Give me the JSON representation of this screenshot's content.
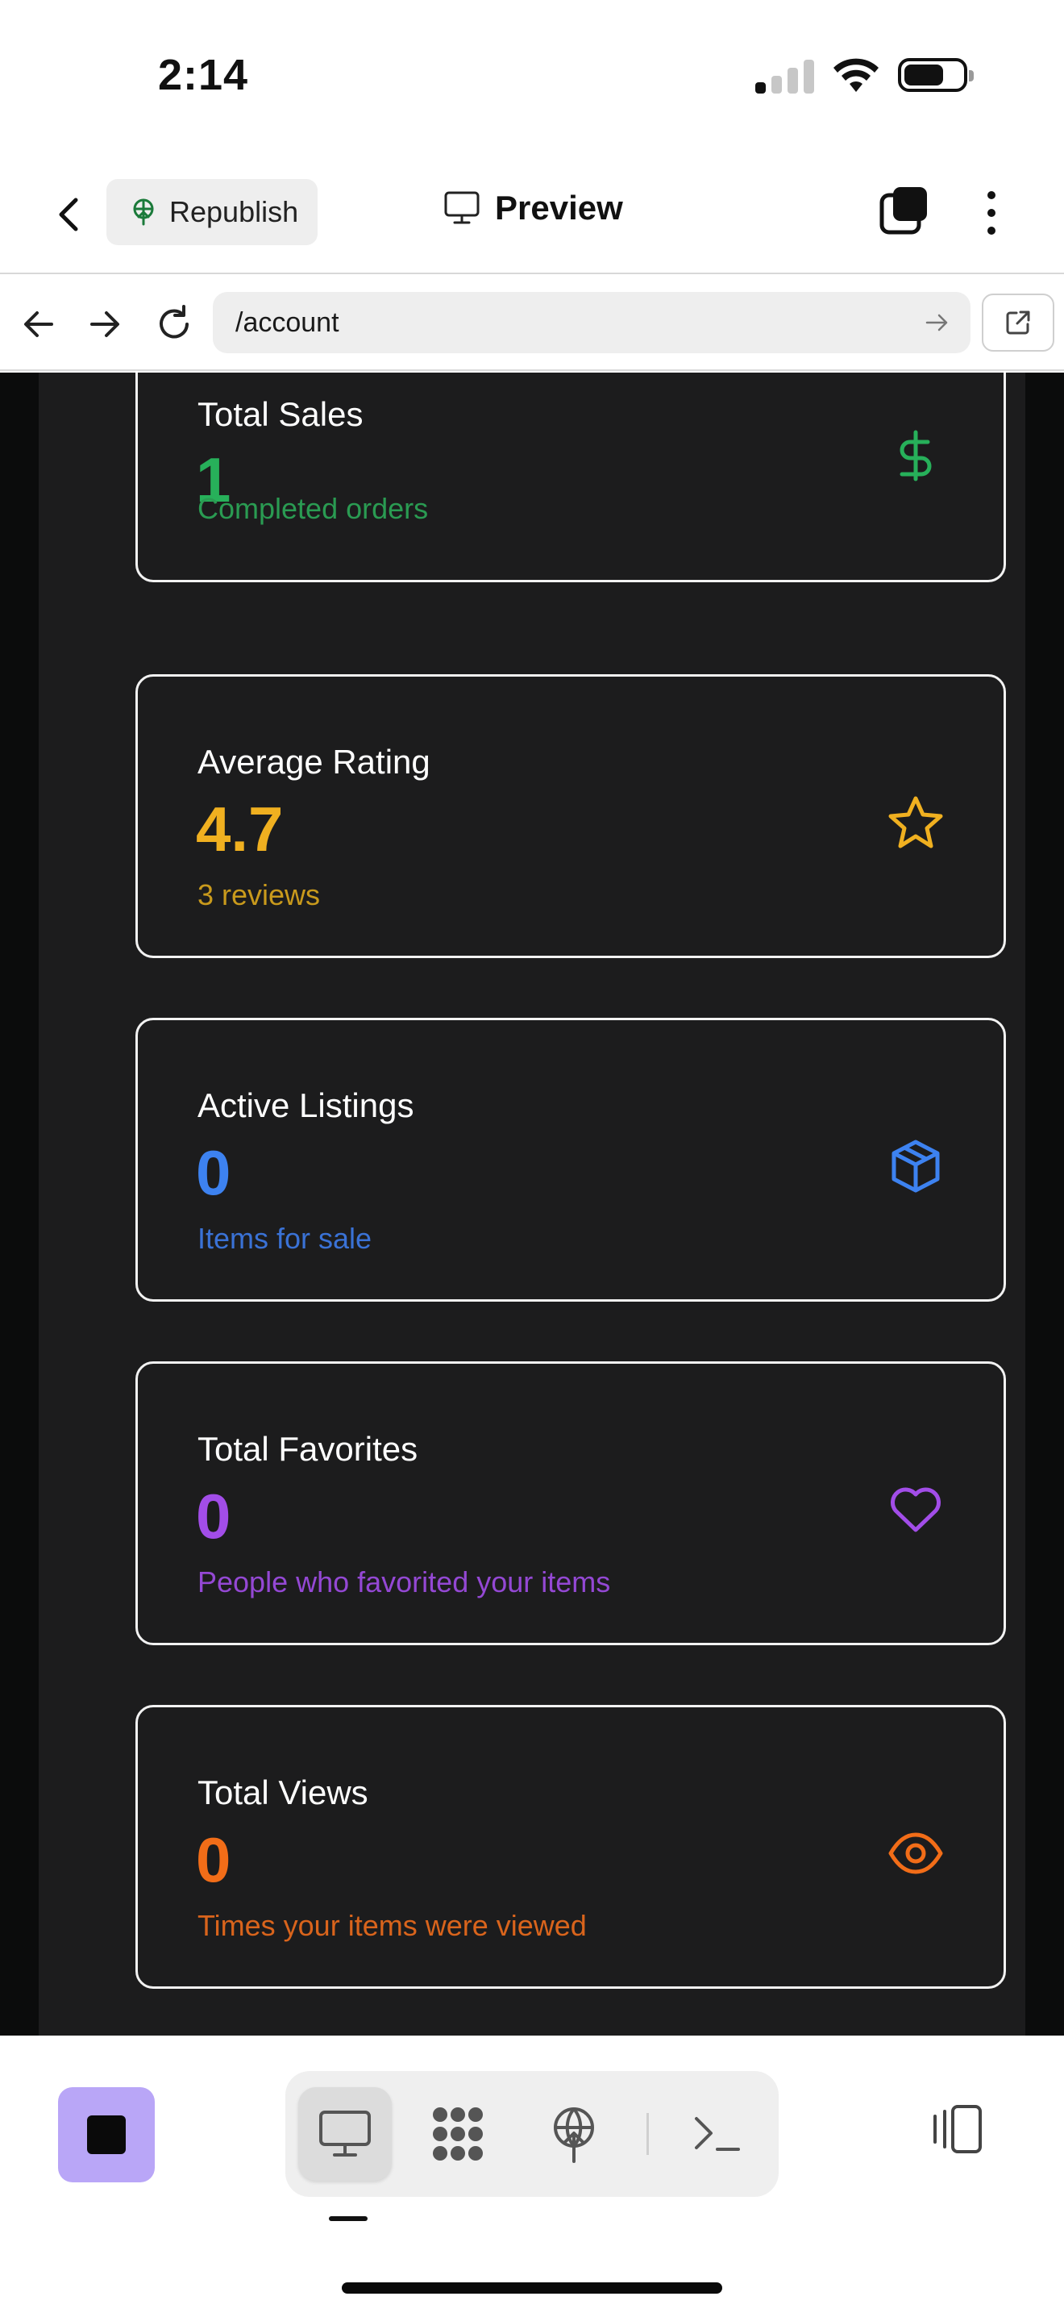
{
  "status_bar": {
    "time": "2:14"
  },
  "header": {
    "republish_label": "Republish",
    "preview_label": "Preview"
  },
  "url_bar": {
    "url": "/account"
  },
  "stats": [
    {
      "label": "Total Sales",
      "value": "1",
      "subtitle": "Completed orders",
      "icon": "dollar-icon",
      "color": "#27b05a",
      "sub_color": "#2a9b52"
    },
    {
      "label": "Average Rating",
      "value": "4.7",
      "subtitle": "3 reviews",
      "icon": "star-icon",
      "color": "#f0b020",
      "sub_color": "#c99a1c"
    },
    {
      "label": "Active Listings",
      "value": "0",
      "subtitle": "Items for sale",
      "icon": "box-icon",
      "color": "#3d82f0",
      "sub_color": "#3a72d6"
    },
    {
      "label": "Total Favorites",
      "value": "0",
      "subtitle": "People who favorited your items",
      "icon": "heart-icon",
      "color": "#a24de8",
      "sub_color": "#9448d4"
    },
    {
      "label": "Total Views",
      "value": "0",
      "subtitle": "Times your items were viewed",
      "icon": "eye-icon",
      "color": "#f26d18",
      "sub_color": "#d9641c"
    }
  ],
  "bottom_toolbar": {
    "items": [
      "desktop-preview",
      "components",
      "publish",
      "terminal"
    ],
    "active": "desktop-preview"
  }
}
